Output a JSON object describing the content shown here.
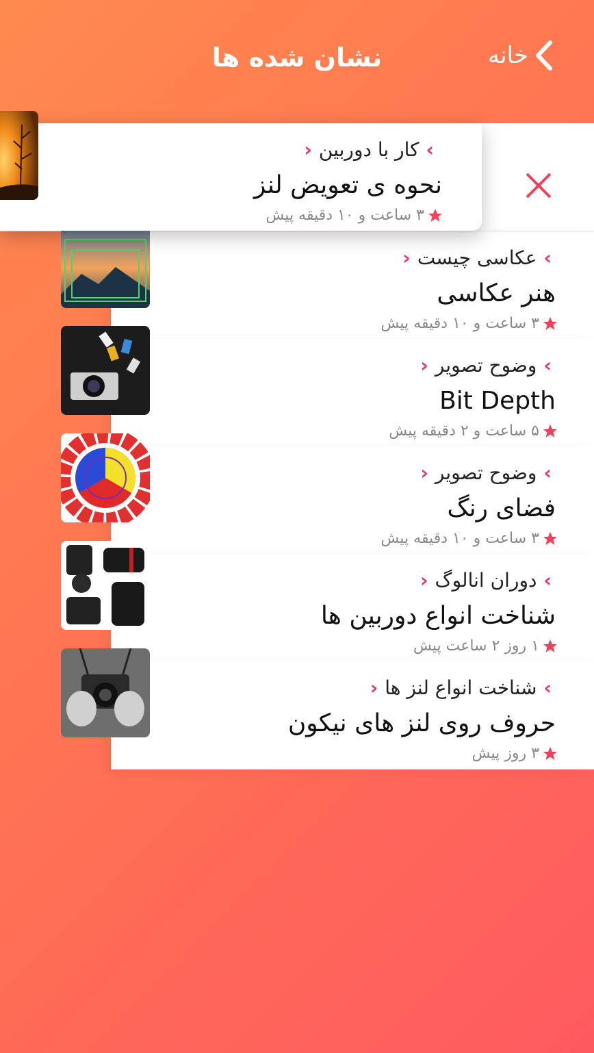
{
  "header": {
    "title": "نشان شده ها",
    "back_label": "خانه"
  },
  "swiped_item": {
    "category": "کار با دوربین",
    "headline": "نحوه ی تعویض لنز",
    "meta": "۳ ساعت و ۱۰ دقیقه پیش"
  },
  "items": [
    {
      "category": "عکاسی چیست",
      "headline": "هنر عکاسی",
      "meta": "۳ ساعت و ۱۰ دقیقه پیش"
    },
    {
      "category": "وضوح تصویر",
      "headline": "Bit Depth",
      "meta": "۵ ساعت و ۲ دقیقه پیش"
    },
    {
      "category": "وضوح تصویر",
      "headline": "فضای رنگ",
      "meta": "۳ ساعت و ۱۰ دقیقه پیش"
    },
    {
      "category": "دوران انالوگ",
      "headline": "شناخت انواع دوربین ها",
      "meta": "۱ روز ۲ ساعت پیش"
    },
    {
      "category": "شناخت انواع لنز ها",
      "headline": "حروف روی لنز های نیکون",
      "meta": "۳ روز پیش"
    }
  ],
  "colors": {
    "accent": "#e8327a",
    "star": "#f0405a",
    "close": "#f0405a"
  },
  "icons": [
    "chevron-back-icon",
    "close-icon",
    "chevron-icon",
    "star-icon"
  ]
}
